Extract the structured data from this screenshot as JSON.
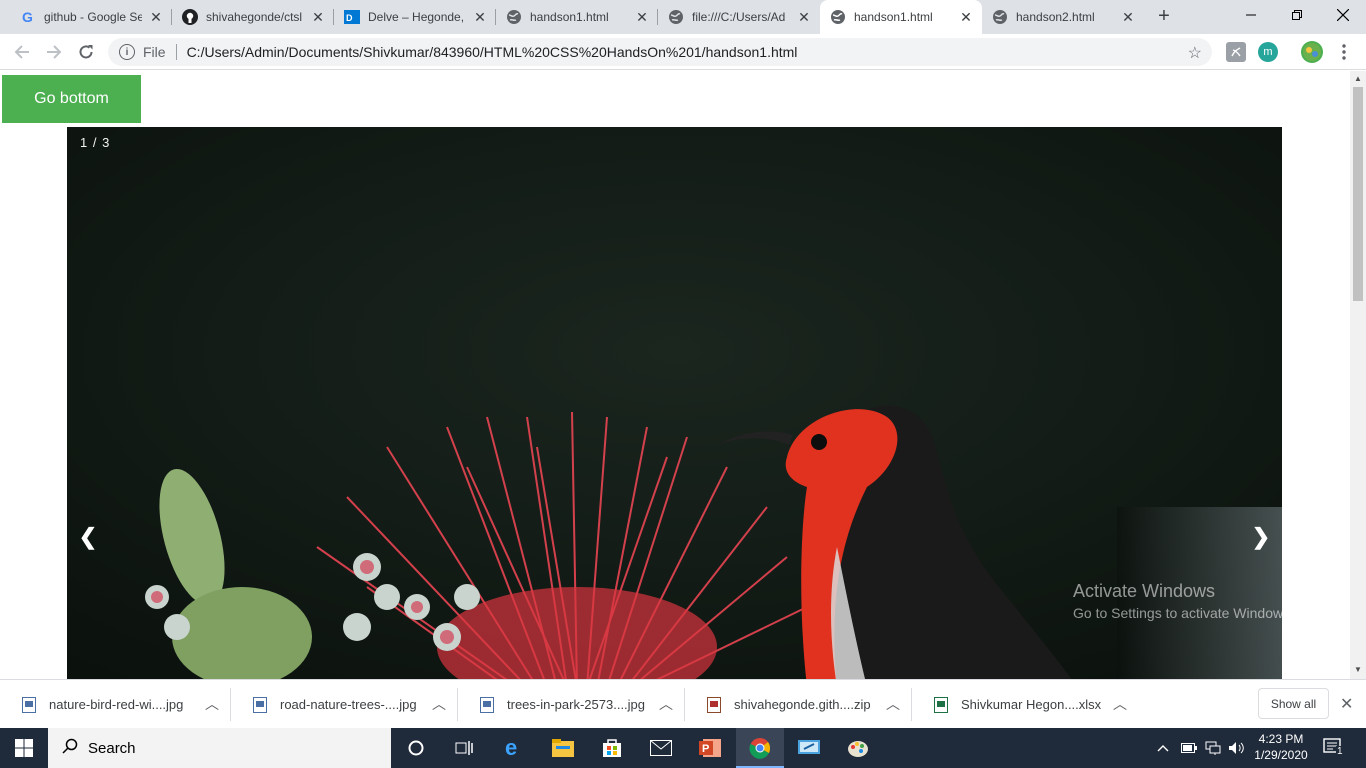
{
  "browser": {
    "tabs": [
      {
        "title": "github - Google Se",
        "icon": "google-icon"
      },
      {
        "title": "shivahegonde/ctsl",
        "icon": "github-icon"
      },
      {
        "title": "Delve – Hegonde,",
        "icon": "delve-icon"
      },
      {
        "title": "handson1.html",
        "icon": "globe-icon"
      },
      {
        "title": "file:///C:/Users/Ad",
        "icon": "globe-icon"
      },
      {
        "title": "handson1.html",
        "icon": "globe-icon",
        "active": true
      },
      {
        "title": "handson2.html",
        "icon": "globe-icon"
      }
    ],
    "new_tab": "+",
    "address": {
      "scheme": "File",
      "url": "C:/Users/Admin/Documents/Shivkumar/843960/HTML%20CSS%20HandsOn%201/handson1.html"
    }
  },
  "page": {
    "go_bottom": "Go bottom",
    "slideshow": {
      "counter": "1 / 3",
      "prev": "❮",
      "next": "❯"
    },
    "watermark": {
      "line1": "Activate Windows",
      "line2": "Go to Settings to activate Windows."
    }
  },
  "downloads": {
    "items": [
      {
        "name": "nature-bird-red-wi....jpg",
        "type": "image"
      },
      {
        "name": "road-nature-trees-....jpg",
        "type": "image"
      },
      {
        "name": "trees-in-park-2573....jpg",
        "type": "image"
      },
      {
        "name": "shivahegonde.gith....zip",
        "type": "zip"
      },
      {
        "name": "Shivkumar Hegon....xlsx",
        "type": "excel"
      }
    ],
    "show_all": "Show all"
  },
  "taskbar": {
    "search_placeholder": "Search",
    "time": "4:23 PM",
    "date": "1/29/2020",
    "notification_count": "1"
  },
  "colors": {
    "accent": "#4caf50",
    "taskbar": "#1f2a3a",
    "tabstrip": "#dee1e6"
  }
}
